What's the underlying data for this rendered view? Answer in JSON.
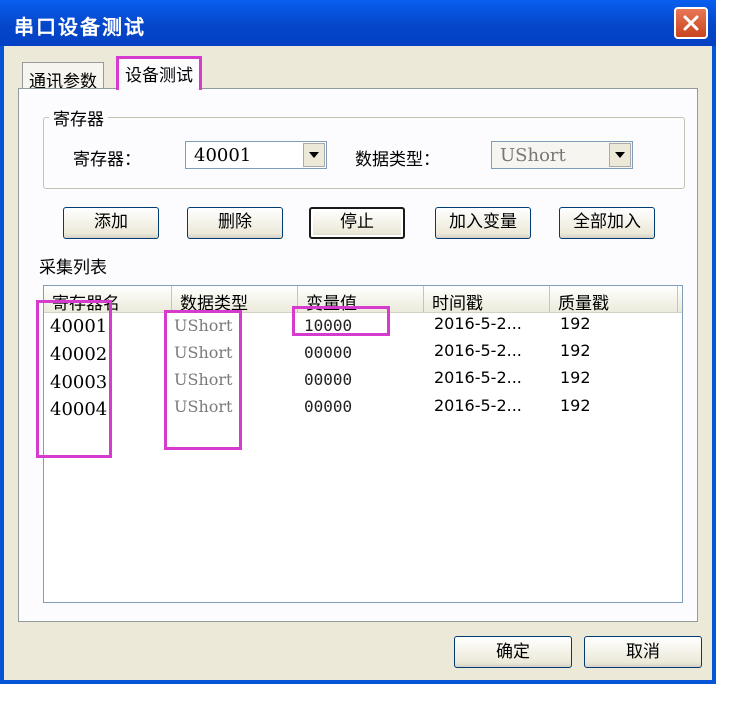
{
  "window": {
    "title": "串口设备测试"
  },
  "tabs": [
    {
      "label": "通讯参数",
      "active": false
    },
    {
      "label": "设备测试",
      "active": true
    }
  ],
  "register_group": {
    "title": "寄存器",
    "register_label": "寄存器：",
    "register_value": "40001",
    "datatype_label": "数据类型：",
    "datatype_value": "UShort"
  },
  "actions": {
    "add": "添加",
    "delete": "删除",
    "stop": "停止",
    "add_variable": "加入变量",
    "add_all": "全部加入"
  },
  "list": {
    "title": "采集列表",
    "columns": [
      "寄存器名",
      "数据类型",
      "变量值",
      "时间戳",
      "质量戳"
    ],
    "rows": [
      {
        "register": "40001",
        "type": "UShort",
        "value": "10000",
        "time": "2016-5-2...",
        "quality": "192"
      },
      {
        "register": "40002",
        "type": "UShort",
        "value": "00000",
        "time": "2016-5-2...",
        "quality": "192"
      },
      {
        "register": "40003",
        "type": "UShort",
        "value": "00000",
        "time": "2016-5-2...",
        "quality": "192"
      },
      {
        "register": "40004",
        "type": "UShort",
        "value": "00000",
        "time": "2016-5-2...",
        "quality": "192"
      }
    ]
  },
  "footer": {
    "ok": "确定",
    "cancel": "取消"
  },
  "colors": {
    "titlebar": "#0547c9",
    "highlight": "#d63bd0",
    "dialog_bg": "#ece9d8"
  }
}
